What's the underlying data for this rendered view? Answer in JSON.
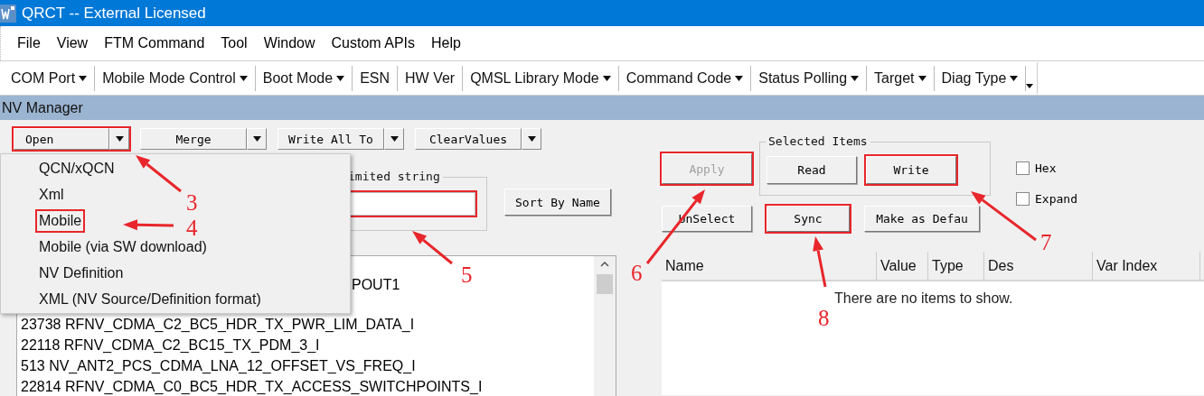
{
  "window": {
    "title": "QRCT -- External Licensed"
  },
  "menu_bar": [
    "File",
    "View",
    "FTM Command",
    "Tool",
    "Window",
    "Custom APIs",
    "Help"
  ],
  "toolbar": [
    {
      "label": "COM Port",
      "dropdown": true
    },
    {
      "label": "Mobile Mode Control",
      "dropdown": true
    },
    {
      "label": "Boot Mode",
      "dropdown": true
    },
    {
      "label": "ESN",
      "dropdown": false
    },
    {
      "label": "HW Ver",
      "dropdown": false
    },
    {
      "label": "QMSL Library Mode",
      "dropdown": true
    },
    {
      "label": "Command Code",
      "dropdown": true
    },
    {
      "label": "Status Polling",
      "dropdown": true
    },
    {
      "label": "Target",
      "dropdown": true
    },
    {
      "label": "Diag Type",
      "dropdown": true
    }
  ],
  "panel": {
    "title": "NV Manager"
  },
  "nv_buttons": [
    {
      "label": "Open",
      "highlighted": true
    },
    {
      "label": "Merge",
      "highlighted": false
    },
    {
      "label": "Write All To",
      "highlighted": false
    },
    {
      "label": "ClearValues",
      "highlighted": false
    }
  ],
  "open_menu": [
    {
      "label": "QCN/xQCN",
      "highlighted": false
    },
    {
      "label": "Xml",
      "highlighted": false
    },
    {
      "label": "Mobile",
      "highlighted": true
    },
    {
      "label": "Mobile (via SW download)",
      "highlighted": false
    },
    {
      "label": "NV Definition",
      "highlighted": false
    },
    {
      "label": "XML (NV Source/Definition format)",
      "highlighted": false
    }
  ],
  "search_group": {
    "legend": "imited string",
    "field_highlighted": true
  },
  "sort_button": "Sort By Name",
  "nv_list": [
    {
      "text": "POUT1",
      "kind": "partial"
    },
    {
      "text": "23738 RFNV_CDMA_C2_BC5_HDR_TX_PWR_LIM_DATA_I",
      "kind": "full"
    },
    {
      "text": "22118 RFNV_CDMA_C2_BC15_TX_PDM_3_I",
      "kind": "full"
    },
    {
      "text": "513 NV_ANT2_PCS_CDMA_LNA_12_OFFSET_VS_FREQ_I",
      "kind": "full"
    },
    {
      "text": "22814 RFNV_CDMA_C0_BC5_HDR_TX_ACCESS_SWITCHPOINTS_I",
      "kind": "full"
    }
  ],
  "apply_button": {
    "label": "Apply",
    "disabled": true,
    "highlighted": true
  },
  "selected_items": {
    "legend": "Selected Items",
    "buttons": [
      {
        "label": "Read",
        "highlighted": false
      },
      {
        "label": "Write",
        "highlighted": true
      }
    ]
  },
  "options": [
    {
      "label": "Hex",
      "checked": false
    },
    {
      "label": "Expand",
      "checked": false
    }
  ],
  "actions": [
    {
      "label": "UnSelect",
      "highlighted": false
    },
    {
      "label": "Sync",
      "highlighted": true
    },
    {
      "label": "Make as Defau",
      "highlighted": false
    }
  ],
  "items_table": {
    "columns": [
      "Name",
      "Value",
      "Type",
      "Des",
      "Var Index"
    ],
    "empty_message": "There are no items to show."
  },
  "annotations": [
    {
      "label": "3"
    },
    {
      "label": "4"
    },
    {
      "label": "5"
    },
    {
      "label": "6"
    },
    {
      "label": "7"
    },
    {
      "label": "8"
    }
  ]
}
